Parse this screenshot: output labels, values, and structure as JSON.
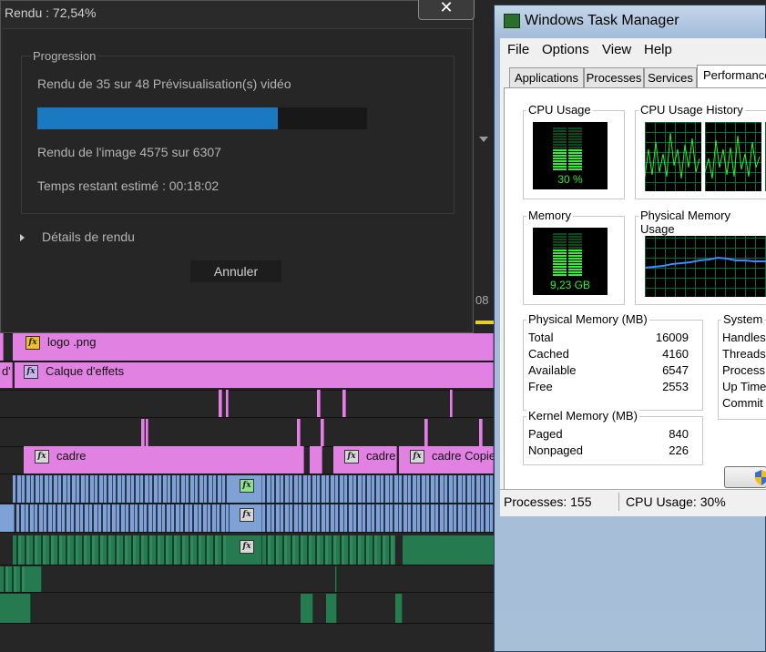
{
  "render": {
    "title": "Rendu : 72,54%",
    "close_label": "✕",
    "group_title": "Progression",
    "line1": "Rendu de 35 sur 48 Prévisualisation(s) vidéo",
    "progress_fraction": 0.73,
    "line2": "Rendu de l'image 4575 sur 6307",
    "line3": "Temps restant estimé : 00:18:02",
    "details_label": "Détails de rendu",
    "cancel_label": "Annuler"
  },
  "timeline": {
    "clips": {
      "logo": "logo .png",
      "calque_prefix": "d'",
      "calque": "Calque d'effets",
      "cadre1": "cadre",
      "cadre2": "cadre",
      "cadre3": "cadre Copie"
    },
    "fx_label": "fx",
    "timecode_fragment": "08"
  },
  "taskmgr": {
    "title": "Windows Task Manager",
    "menu": [
      "File",
      "Options",
      "View",
      "Help"
    ],
    "tabs": [
      "Applications",
      "Processes",
      "Services",
      "Performance"
    ],
    "active_tab": "Performance",
    "cpu_usage_title": "CPU Usage",
    "cpu_usage_value": "30 %",
    "cpu_history_title": "CPU Usage History",
    "memory_title": "Memory",
    "memory_value": "9,23 GB",
    "physical_history_title": "Physical Memory Usage",
    "physical_memory": {
      "title": "Physical Memory (MB)",
      "rows": [
        {
          "label": "Total",
          "value": "16009"
        },
        {
          "label": "Cached",
          "value": "4160"
        },
        {
          "label": "Available",
          "value": "6547"
        },
        {
          "label": "Free",
          "value": "2553"
        }
      ]
    },
    "kernel_memory": {
      "title": "Kernel Memory (MB)",
      "rows": [
        {
          "label": "Paged",
          "value": "840"
        },
        {
          "label": "Nonpaged",
          "value": "226"
        }
      ]
    },
    "system": {
      "title": "System",
      "rows": [
        "Handles",
        "Threads",
        "Process",
        "Up Time",
        "Commit"
      ]
    },
    "status": {
      "processes": "Processes: 155",
      "cpu": "CPU Usage: 30%"
    }
  }
}
